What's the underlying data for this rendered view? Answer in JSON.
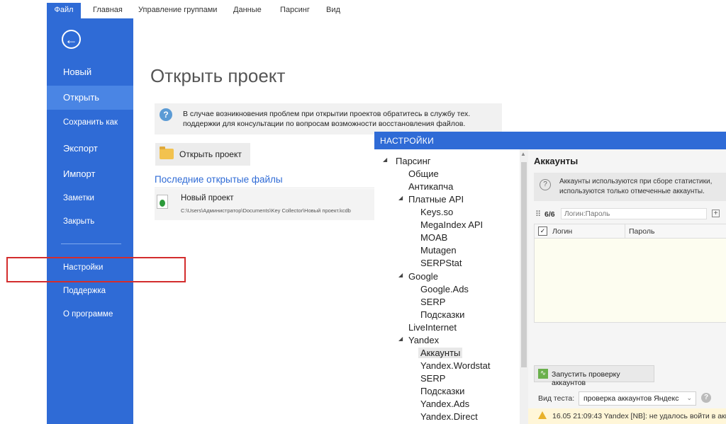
{
  "ribbon": {
    "tabs": [
      "Файл",
      "Главная",
      "Управление группами",
      "Данные",
      "Парсинг",
      "Вид"
    ]
  },
  "sidebar": {
    "back": "←",
    "items": [
      "Новый",
      "Открыть",
      "Сохранить как",
      "Экспорт",
      "Импорт",
      "Заметки",
      "Закрыть",
      "Настройки",
      "Поддержка",
      "О программе"
    ]
  },
  "main": {
    "title": "Открыть проект",
    "help_mark": "?",
    "info_text": "В случае возникновения проблем при открытии проектов обратитесь в службу тех. поддержки для консультации по вопросам возможности восстановления файлов.",
    "open_button": "Открыть проект",
    "recent_heading": "Последние открытые файлы",
    "recent_name": "Новый проект",
    "recent_path": "C:\\Users\\Администратор\\Documents\\Key Collector\\Новый проект.kcdb"
  },
  "settings": {
    "title": "НАСТРОЙКИ",
    "tree": [
      "Парсинг",
      "Общие",
      "Антикапча",
      "Платные API",
      "Keys.so",
      "MegaIndex API",
      "MOAB",
      "Mutagen",
      "SERPStat",
      "Google",
      "Google.Ads",
      "SERP",
      "Подсказки",
      "LiveInternet",
      "Yandex",
      "Аккаунты",
      "Yandex.Wordstat",
      "SERP",
      "Подсказки",
      "Yandex.Ads",
      "Yandex.Direct"
    ],
    "accounts": {
      "heading": "Аккаунты",
      "note": "Аккаунты используются при сборе статистики, используются только отмеченные аккаунты.",
      "count": "6/6",
      "input_placeholder": "Логин:Пароль",
      "col_login": "Логин",
      "col_password": "Пароль",
      "run_button": "Запустить проверку аккаунтов",
      "mode_label": "Вид теста:",
      "mode_value": "проверка аккаунтов Яндекс",
      "log": "16.05 21:09:43  Yandex [NB]: не удалось войти в акк"
    }
  }
}
